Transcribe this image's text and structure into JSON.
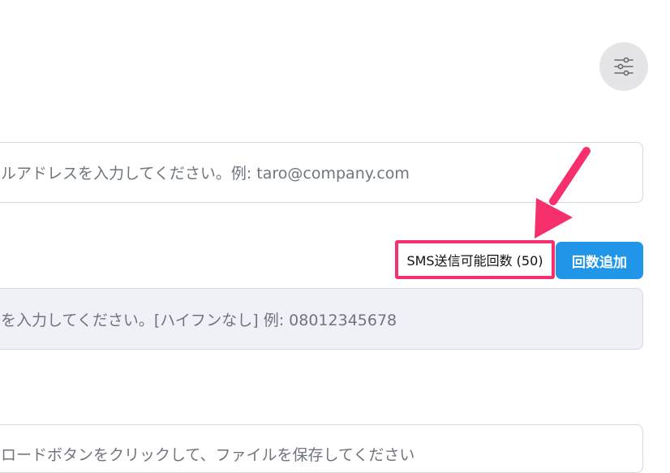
{
  "filter_button": {
    "icon": "sliders-icon"
  },
  "email_field": {
    "placeholder": "ルアドレスを入力してください。例: taro@company.com"
  },
  "sms": {
    "count_label": "SMS送信可能回数 (50)",
    "add_button_label": "回数追加"
  },
  "phone_field": {
    "placeholder": "を入力してください。[ハイフンなし] 例: 08012345678"
  },
  "upload_field": {
    "placeholder": "ロードボタンをクリックして、ファイルを保存してください"
  },
  "annotation": {
    "arrow_color": "#f5306d",
    "highlight_color": "#f5306d"
  },
  "colors": {
    "accent": "#2196e8",
    "field_disabled_bg": "#f0f0f7"
  }
}
